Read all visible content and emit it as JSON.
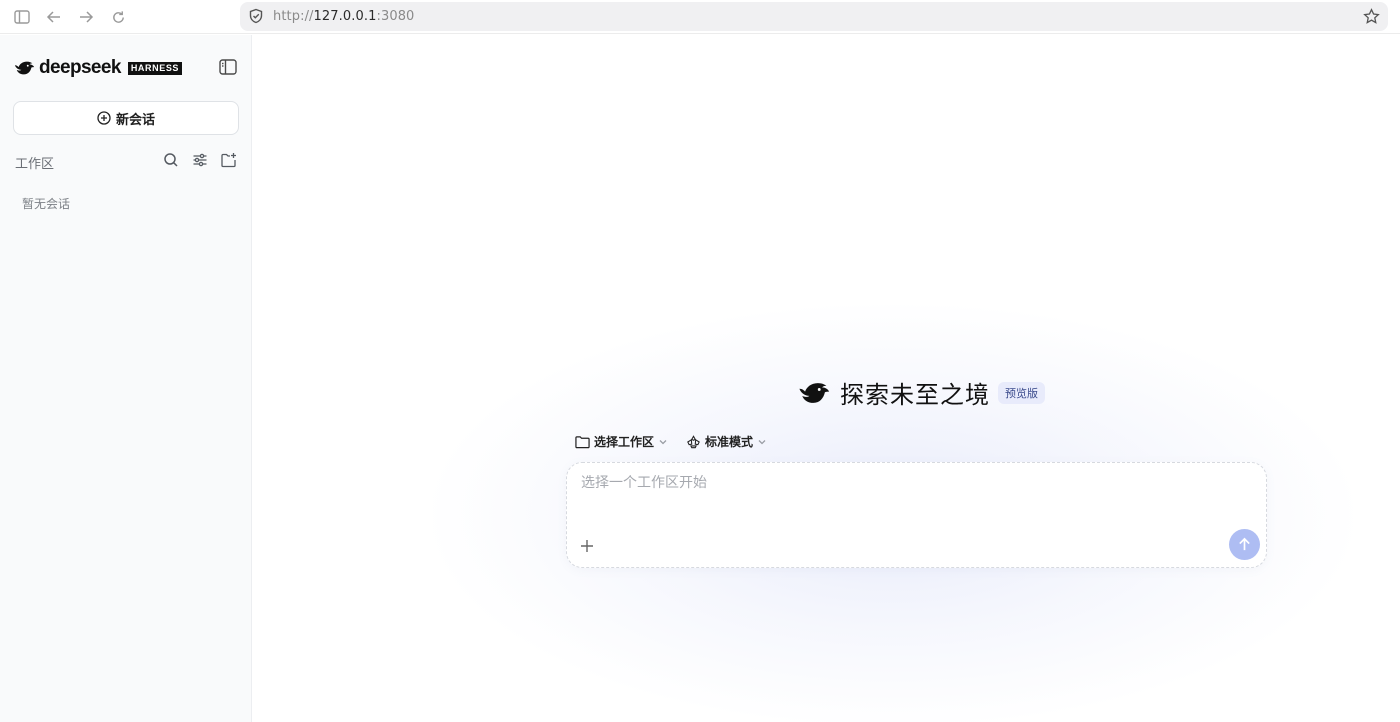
{
  "browser": {
    "url_scheme": "http://",
    "url_host": "127.0.0.1",
    "url_port": ":3080"
  },
  "sidebar": {
    "brand_name": "deepseek",
    "brand_badge": "HARNESS",
    "new_chat_label": "新会话",
    "workspace_label": "工作区",
    "empty_label": "暂无会话"
  },
  "main": {
    "title": "探索未至之境",
    "badge": "预览版",
    "workspace_selector": "选择工作区",
    "mode_selector": "标准模式",
    "input_placeholder": "选择一个工作区开始"
  },
  "colors": {
    "accent": "#aebdf3",
    "badge_bg": "#e8ebfb",
    "sidebar_bg": "#f9fafb"
  },
  "icons": {
    "sidebar_toggle": "sidebar-toggle-icon",
    "search": "search-icon",
    "filter": "filter-icon",
    "new_folder": "new-folder-icon",
    "attach": "plus-icon",
    "send": "arrow-up-icon"
  }
}
